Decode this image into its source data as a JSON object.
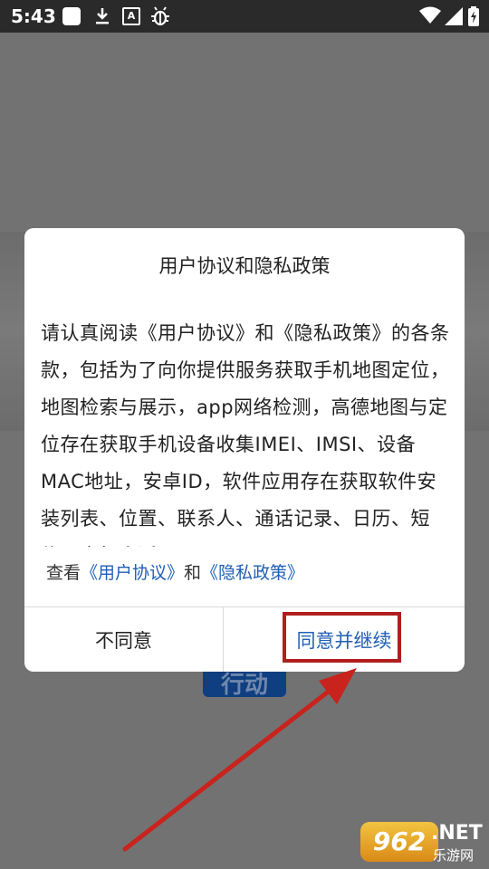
{
  "status_bar": {
    "time": "5:43",
    "notification_icons": [
      "square-notification-icon",
      "download-icon",
      "a-badge-icon",
      "bug-icon"
    ],
    "system_icons": [
      "wifi-icon",
      "signal-icon",
      "battery-charging-icon"
    ]
  },
  "background": {
    "button_text": "行动"
  },
  "dialog": {
    "title": "用户协议和隐私政策",
    "body": "请认真阅读《用户协议》和《隐私政策》的各条款，包括为了向你提供服务获取手机地图定位，地图检索与展示，app网络检测，高德地图与定位存在获取手机设备收集IMEI、IMSI、设备MAC地址，安卓ID，软件应用存在获取软件安装列表、位置、联系人、通话记录、日历、短信、本机电话号",
    "links_prefix": "查看",
    "user_agreement_link": "《用户协议》",
    "links_and": "和",
    "privacy_policy_link": "《隐私政策》",
    "disagree_button": "不同意",
    "agree_button": "同意并继续"
  },
  "annotation": {
    "highlight_color": "#b01e1e",
    "arrow_color": "#c8231d"
  },
  "watermark": {
    "badge": "962",
    "domain": ".NET",
    "site_name": "乐游网"
  },
  "colors": {
    "link": "#1f5fb5",
    "status_bar": "#2a2a2a",
    "overlay": "#727272"
  }
}
